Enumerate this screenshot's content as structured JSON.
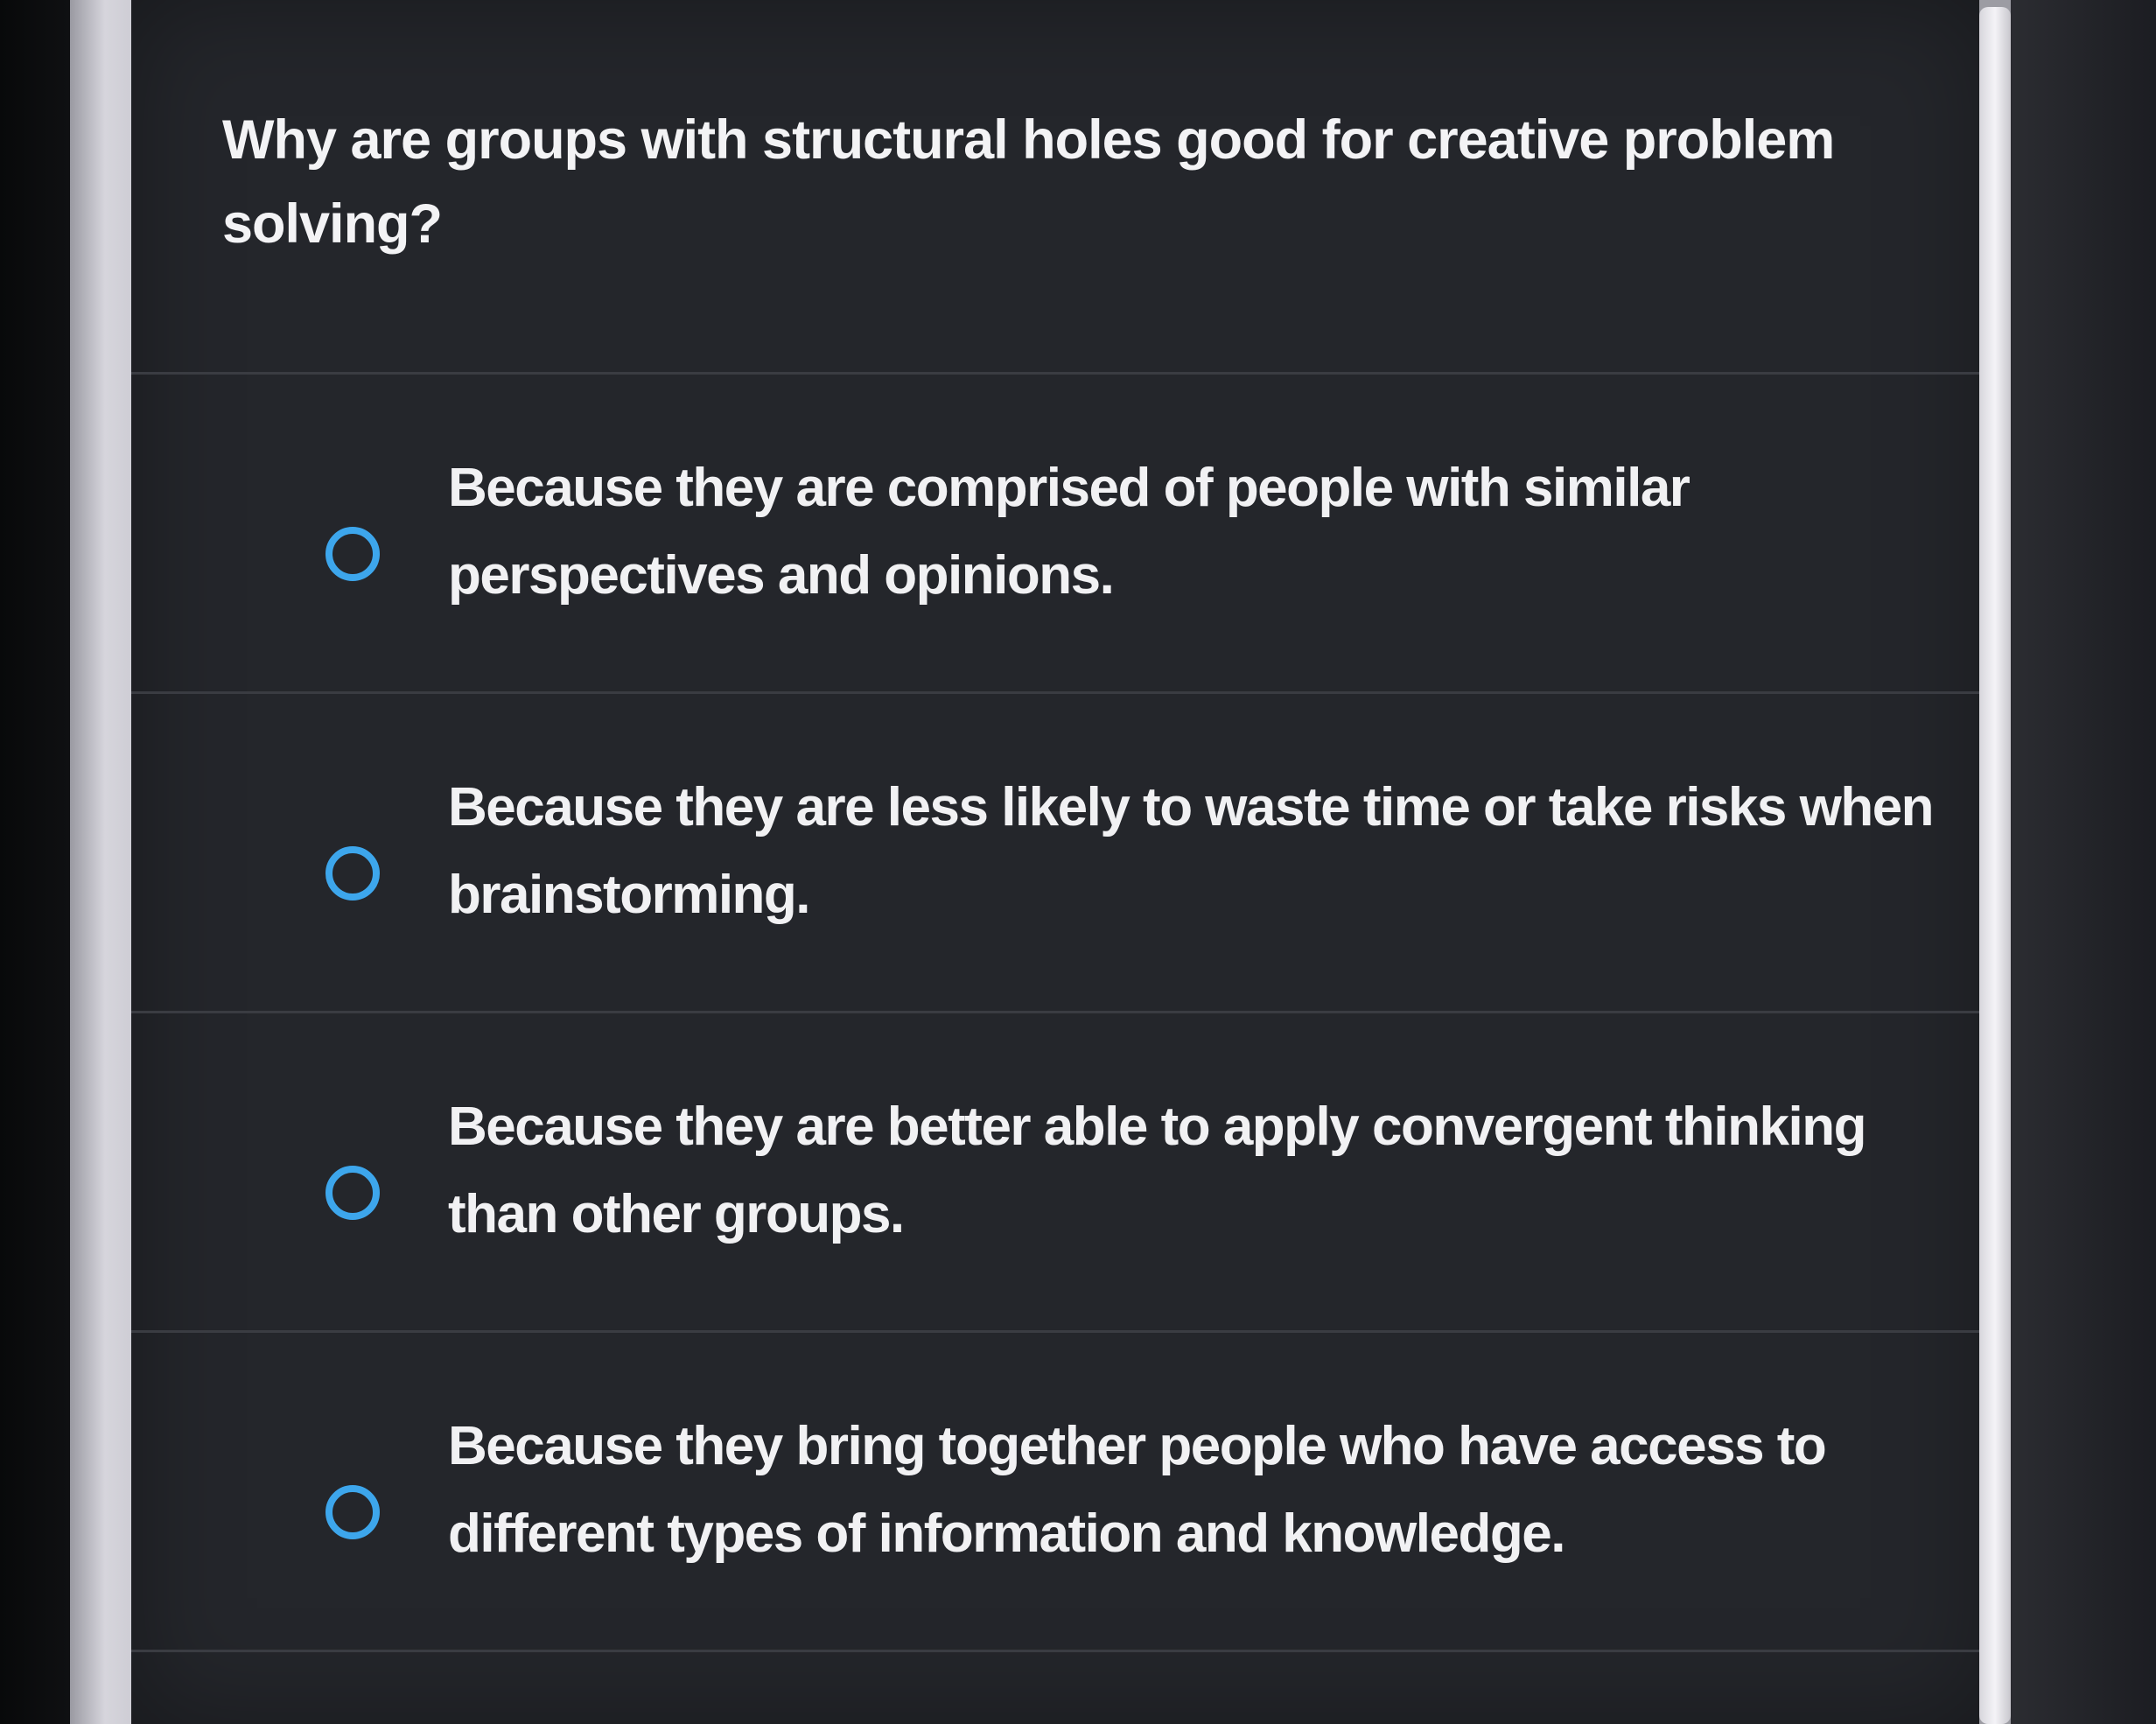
{
  "question": {
    "text": "Why are groups with structural holes good for creative problem solving?"
  },
  "options": [
    {
      "label": "Because they are comprised of people with similar perspectives and opinions.",
      "selected": false
    },
    {
      "label": "Because they are less likely to waste time or take risks when brainstorming.",
      "selected": false
    },
    {
      "label": "Because they are better able to apply convergent thinking than other groups.",
      "selected": false
    },
    {
      "label": "Because they bring together people who have access to different types of information and knowledge.",
      "selected": false
    }
  ],
  "colors": {
    "accent": "#3da6ec",
    "background": "#24262b",
    "text": "#f1f1f3"
  }
}
